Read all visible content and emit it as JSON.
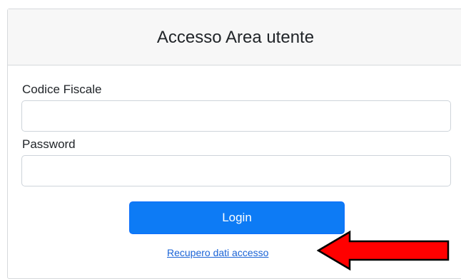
{
  "header": {
    "title": "Accesso Area utente"
  },
  "form": {
    "codice_fiscale_label": "Codice Fiscale",
    "codice_fiscale_value": "",
    "password_label": "Password",
    "password_value": "",
    "login_label": "Login",
    "recovery_link": "Recupero dati accesso"
  },
  "annotation": {
    "arrow_color": "#ff0000",
    "arrow_outline": "#000000",
    "icon": "left-arrow-icon"
  },
  "colors": {
    "accent": "#0d7bf5",
    "link": "#1a63d6",
    "header_bg": "#f7f7f7"
  }
}
